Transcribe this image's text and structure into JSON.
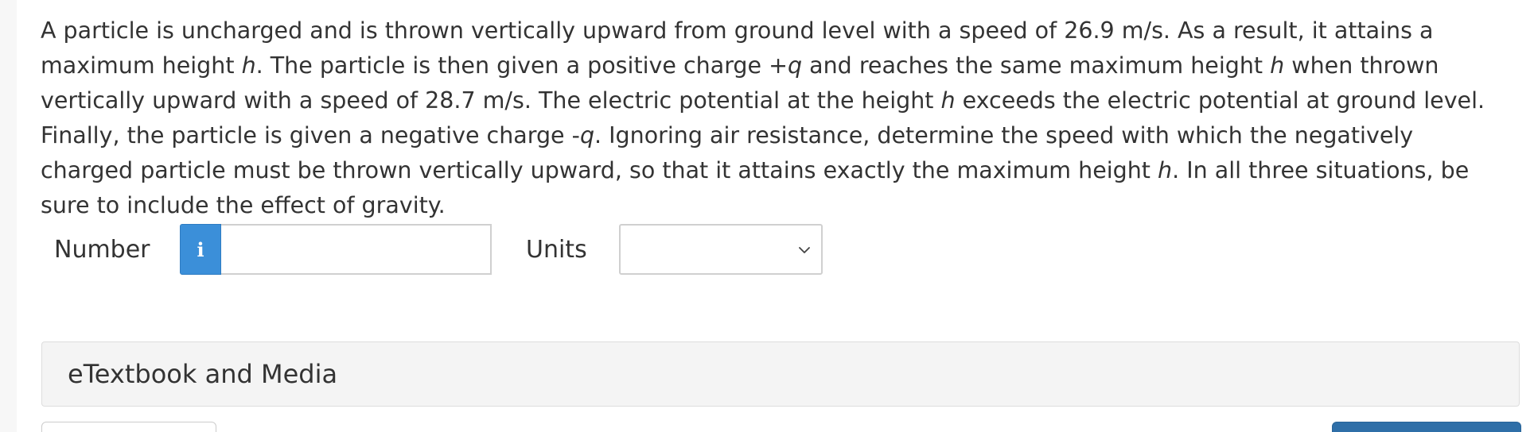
{
  "question": {
    "parts": [
      "A particle is uncharged and is thrown vertically upward from ground level with a speed of 26.9 m/s. As a result, it attains a maximum height ",
      "h",
      ". The particle is then given a positive charge +",
      "q",
      " and reaches the same maximum height ",
      "h",
      " when thrown vertically upward with a speed of 28.7 m/s. The electric potential at the height ",
      "h",
      " exceeds the electric potential at ground level. Finally, the particle is given a negative charge -",
      "q",
      ". Ignoring air resistance, determine the speed with which the negatively charged particle must be thrown vertically upward, so that it attains exactly the maximum height ",
      "h",
      ". In all three situations, be sure to include the effect of gravity."
    ]
  },
  "answer": {
    "number_label": "Number",
    "info_icon": "info-icon",
    "info_glyph": "i",
    "number_value": "",
    "units_label": "Units",
    "units_selected": "",
    "units_icon": "chevron-down-icon"
  },
  "resources": {
    "etextbook_label": "eTextbook and Media"
  },
  "colors": {
    "info_button": "#3b8fd9",
    "primary_button": "#2f6fa8",
    "panel_bg": "#f4f4f4",
    "text": "#333333"
  }
}
